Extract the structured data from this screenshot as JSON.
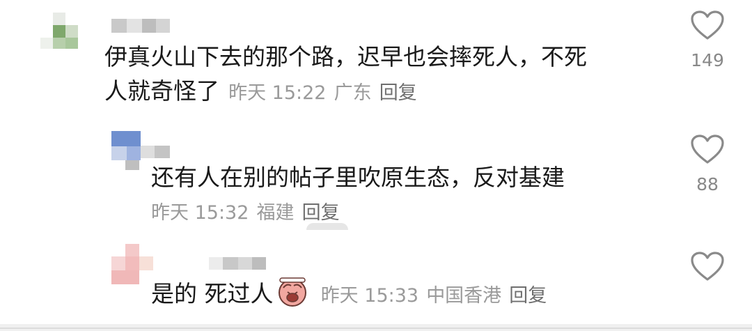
{
  "comments": [
    {
      "text_line1": "伊真火山下去的那个路，迟早也会摔死人，不死",
      "text_line2": "人就奇怪了",
      "time": "昨天 15:22",
      "location": "广东",
      "reply_label": "回复",
      "likes": "149"
    },
    {
      "text": "还有人在别的帖子里吹原生态，反对基建",
      "time": "昨天 15:32",
      "location": "福建",
      "reply_label": "回复",
      "likes": "88"
    },
    {
      "text": "是的 死过人",
      "emoji": "crying-face-emoji",
      "time": "昨天 15:33",
      "location": "中国香港",
      "reply_label": "回复"
    }
  ],
  "icons": {
    "like": "heart-outline-icon"
  },
  "colors": {
    "text": "#1a1a1a",
    "meta": "#9a9a9a",
    "icon": "#8a8a8a"
  }
}
